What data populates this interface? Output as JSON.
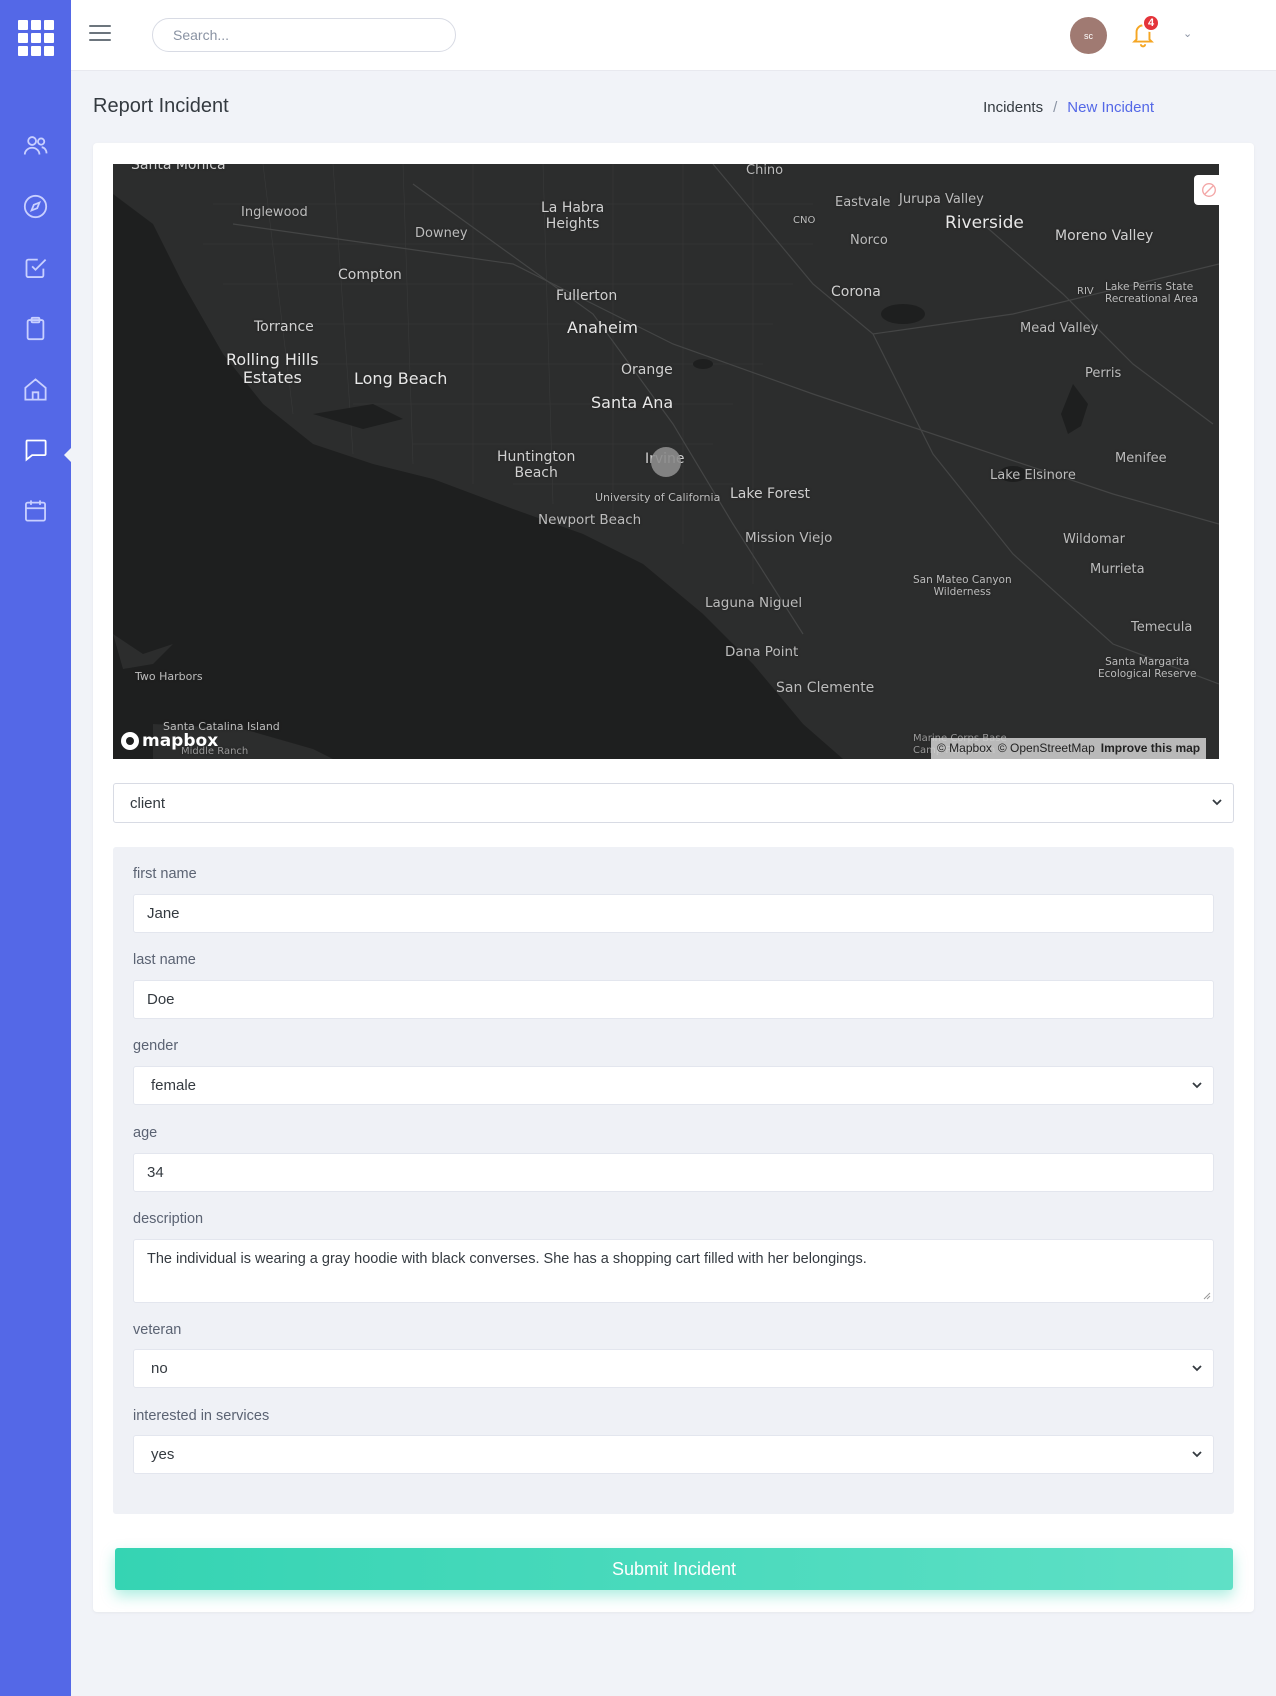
{
  "topbar": {
    "search_placeholder": "Search...",
    "avatar_initials": "sc",
    "notification_count": "4"
  },
  "sidebar": {
    "items": [
      {
        "icon": "users-icon"
      },
      {
        "icon": "compass-icon"
      },
      {
        "icon": "checkbox-icon"
      },
      {
        "icon": "clipboard-icon"
      },
      {
        "icon": "home-icon"
      },
      {
        "icon": "chat-icon",
        "active": true
      },
      {
        "icon": "calendar-icon"
      }
    ]
  },
  "header": {
    "title": "Report Incident",
    "breadcrumb": [
      "Incidents",
      "New Incident"
    ],
    "breadcrumb_sep": "/"
  },
  "map": {
    "places": {
      "santa_monica": "Santa Monica",
      "inglewood": "Inglewood",
      "downey": "Downey",
      "la_habra": "La Habra\nHeights",
      "chino": "Chino",
      "cno": "CNO",
      "eastvale": "Eastvale",
      "jurupa": "Jurupa Valley",
      "riverside": "Riverside",
      "moreno": "Moreno Valley",
      "norco": "Norco",
      "compton": "Compton",
      "fullerton": "Fullerton",
      "corona": "Corona",
      "riv": "RIV",
      "lake_perris": "Lake Perris State\nRecreational Area",
      "torrance": "Torrance",
      "anaheim": "Anaheim",
      "mead": "Mead Valley",
      "rolling": "Rolling Hills\nEstates",
      "long_beach": "Long Beach",
      "orange": "Orange",
      "santa_ana": "Santa Ana",
      "perris": "Perris",
      "huntington": "Huntington\nBeach",
      "irvine": "Irvine",
      "uc": "University of California",
      "lake_forest": "Lake Forest",
      "lake_elsinore": "Lake Elsinore",
      "menifee": "Menifee",
      "newport": "Newport Beach",
      "mission": "Mission Viejo",
      "wildomar": "Wildomar",
      "san_mateo": "San Mateo Canyon\nWilderness",
      "murrieta": "Murrieta",
      "laguna": "Laguna Niguel",
      "temecula": "Temecula",
      "dana": "Dana Point",
      "santa_margarita": "Santa Margarita\nEcological Reserve",
      "two_harbors": "Two Harbors",
      "san_clemente": "San Clemente",
      "catalina": "Santa Catalina Island",
      "middle_ranch": "Middle Ranch",
      "marine": "Marine Corps Base\nCamp Pendleton"
    },
    "logo": "mapbox",
    "attribution": [
      "© Mapbox",
      "© OpenStreetMap",
      "Improve this map"
    ]
  },
  "form": {
    "type_select": "client",
    "fields": {
      "first_name": {
        "label": "first name",
        "value": "Jane"
      },
      "last_name": {
        "label": "last name",
        "value": "Doe"
      },
      "gender": {
        "label": "gender",
        "value": "female"
      },
      "age": {
        "label": "age",
        "value": "34"
      },
      "description": {
        "label": "description",
        "value": "The individual is wearing a gray hoodie with black converses. She has a shopping cart filled with her belongings."
      },
      "veteran": {
        "label": "veteran",
        "value": "no"
      },
      "interested": {
        "label": "interested in services",
        "value": "yes"
      }
    },
    "submit_label": "Submit Incident"
  },
  "colors": {
    "sidebar": "#5468e7",
    "accent": "#5468e7",
    "submit": "#35d4b3",
    "badge": "#e4343a",
    "map_bg": "#1e1f1f"
  }
}
